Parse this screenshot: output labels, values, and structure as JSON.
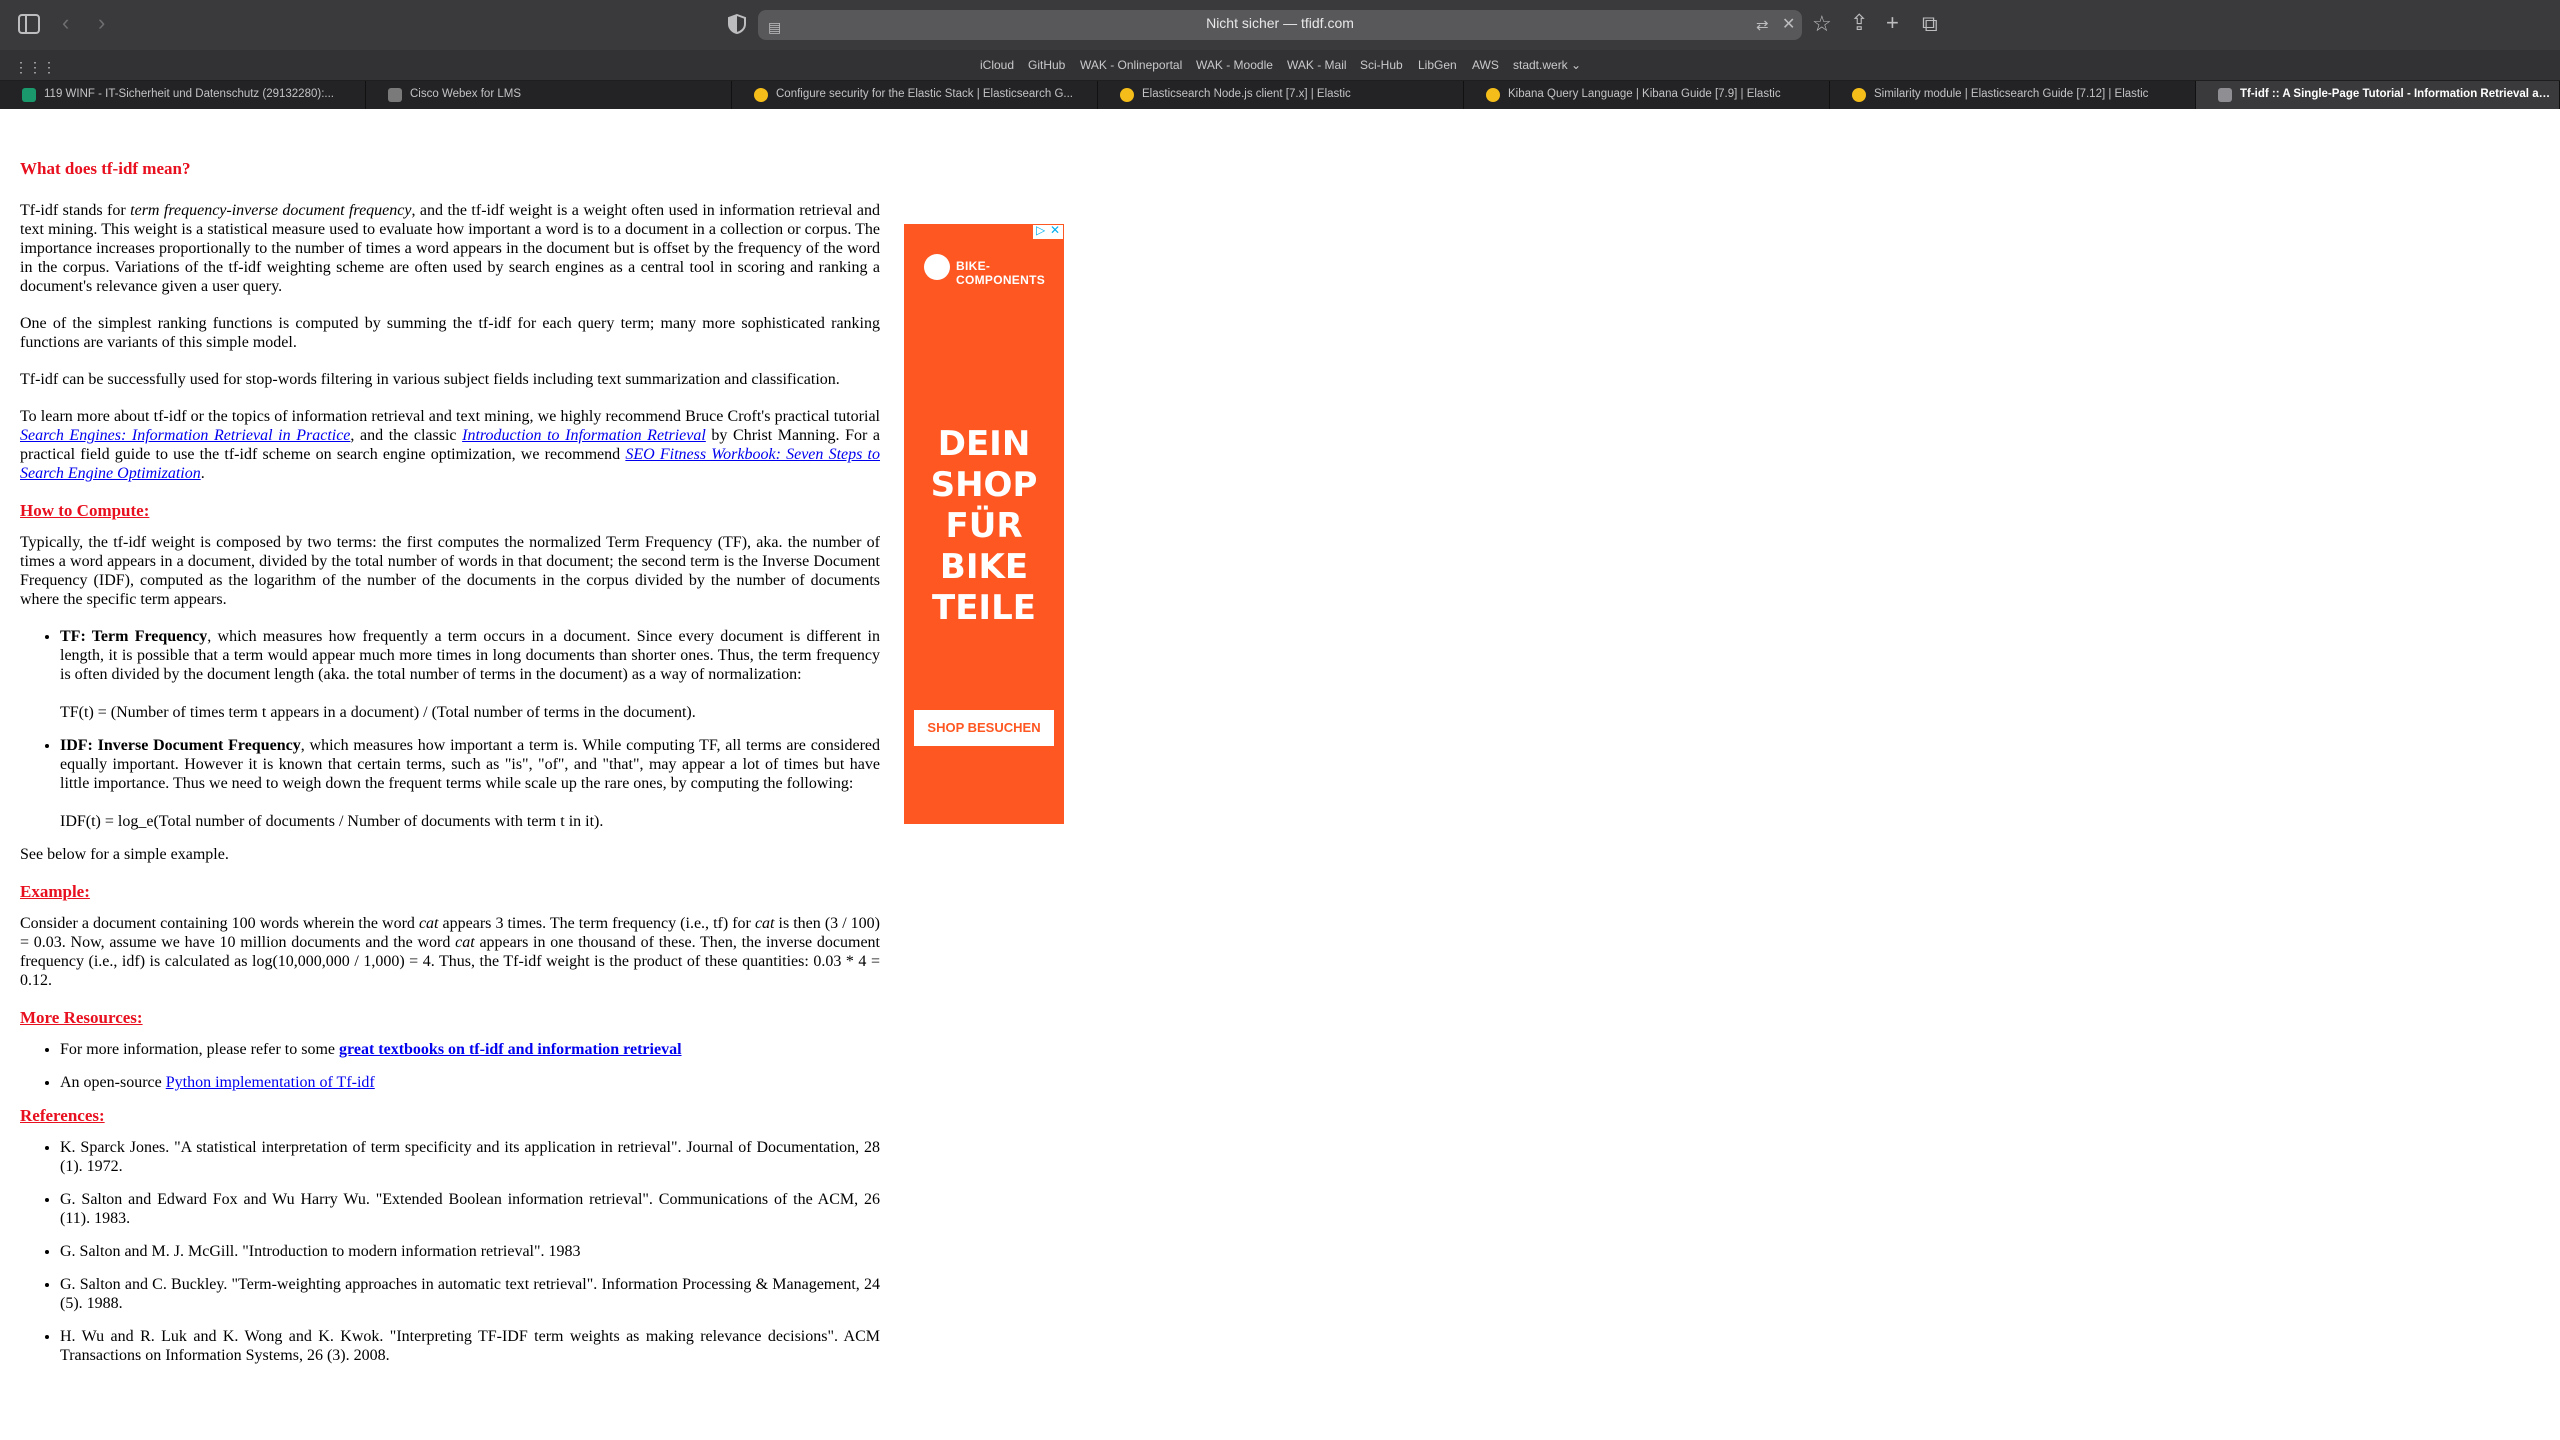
{
  "browser": {
    "address_text": "Nicht sicher — tfidf.com",
    "favorites": [
      "iCloud",
      "GitHub",
      "WAK - Onlineportal",
      "WAK - Moodle",
      "WAK - Mail",
      "Sci-Hub",
      "LibGen",
      "AWS",
      "stadt.werk ⌄"
    ],
    "tabs": [
      {
        "label": "119 WINF - IT-Sicherheit und Datenschutz (29132280):...",
        "favicon_color": "#1a9a6c"
      },
      {
        "label": "Cisco Webex for LMS",
        "favicon_color": "#7a7a7a"
      },
      {
        "label": "Configure security for the Elastic Stack | Elasticsearch G...",
        "favicon_color": "#f4bd19"
      },
      {
        "label": "Elasticsearch Node.js client [7.x] | Elastic",
        "favicon_color": "#f4bd19"
      },
      {
        "label": "Kibana Query Language | Kibana Guide [7.9] | Elastic",
        "favicon_color": "#f4bd19"
      },
      {
        "label": "Similarity module | Elasticsearch Guide [7.12] | Elastic",
        "favicon_color": "#f4bd19"
      },
      {
        "label": "Tf-idf :: A Single-Page Tutorial - Information Retrieval an...",
        "favicon_color": "#8e8e93"
      }
    ]
  },
  "article": {
    "title": "What does tf-idf mean?",
    "intro_1": "Tf-idf stands for ",
    "intro_em": "term frequency-inverse document frequency",
    "intro_2": ", and the tf-idf weight is a weight often used in information retrieval and text mining. This weight is a statistical measure used to evaluate how important a word is to a document in a collection or corpus. The importance increases proportionally to the number of times a word appears in the document but is offset by the frequency of the word in the corpus. Variations of the tf-idf weighting scheme are often used by search engines as a central tool in scoring and ranking a document's relevance given a user query.",
    "para_2": "One of the simplest ranking functions is computed by summing the tf-idf for each query term; many more sophisticated ranking functions are variants of this simple model.",
    "para_3": "Tf-idf can be successfully used for stop-words filtering in various subject fields including text summarization and classification.",
    "para_4a": "To learn more about tf-idf or the topics of information retrieval and text mining, we highly recommend Bruce Croft's practical tutorial ",
    "link_1": "Search Engines: Information Retrieval in Practice",
    "para_4b": ", and the classic ",
    "link_2": "Introduction to Information Retrieval",
    "para_4c": " by Christ Manning. For a practical field guide to use the tf-idf scheme on search engine optimization, we recommend ",
    "link_3": "SEO Fitness Workbook: Seven Steps to Search Engine Optimization",
    "para_4d": ".",
    "h_compute": "How to Compute:",
    "compute_p": "Typically, the tf-idf weight is composed by two terms: the first computes the normalized Term Frequency (TF), aka. the number of times a word appears in a document, divided by the total number of words in that document; the second term is the Inverse Document Frequency (IDF), computed as the logarithm of the number of the documents in the corpus divided by the number of documents where the specific term appears.",
    "tf_title": "TF: Term Frequency",
    "tf_text": ", which measures how frequently a term occurs in a document. Since every document is different in length, it is possible that a term would appear much more times in long documents than shorter ones. Thus, the term frequency is often divided by the document length (aka. the total number of terms in the document) as a way of normalization:",
    "tf_formula": "TF(t) = (Number of times term t appears in a document) / (Total number of terms in the document).",
    "idf_title": "IDF: Inverse Document Frequency",
    "idf_text": ", which measures how important a term is. While computing TF, all terms are considered equally important. However it is known that certain terms, such as \"is\", \"of\", and \"that\", may appear a lot of times but have little importance. Thus we need to weigh down the frequent terms while scale up the rare ones, by computing the following:",
    "idf_formula": "IDF(t) = log_e(Total number of documents / Number of documents with term t in it).",
    "see_below": "See below for a simple example.",
    "h_example": "Example:",
    "ex_1": "Consider a document containing 100 words wherein the word ",
    "ex_cat1": "cat",
    "ex_2": " appears 3 times. The term frequency (i.e., tf) for ",
    "ex_cat2": "cat",
    "ex_3": " is then (3 / 100) = 0.03. Now, assume we have 10 million documents and the word ",
    "ex_cat3": "cat",
    "ex_4": " appears in one thousand of these. Then, the inverse document frequency (i.e., idf) is calculated as log(10,000,000 / 1,000) = 4. Thus, the Tf-idf weight is the product of these quantities: 0.03 * 4 = 0.12.",
    "h_resources": "More Resources:",
    "res_1_text": "For more information, please refer to some ",
    "res_1_link": "great textbooks on tf-idf and information retrieval",
    "res_2_text": "An open-source ",
    "res_2_link": "Python implementation of Tf-idf",
    "h_references": "References:",
    "references": [
      "K. Sparck Jones. \"A statistical interpretation of term specificity and its application in retrieval\". Journal of Documentation, 28 (1). 1972.",
      "G. Salton and Edward Fox and Wu Harry Wu. \"Extended Boolean information retrieval\". Communications of the ACM, 26 (11). 1983.",
      "G. Salton and M. J. McGill. \"Introduction to modern information retrieval\". 1983",
      "G. Salton and C. Buckley. \"Term-weighting approaches in automatic text retrieval\". Information Processing & Management, 24 (5). 1988.",
      "H. Wu and R. Luk and K. Wong and K. Kwok. \"Interpreting TF-IDF term weights as making relevance decisions\". ACM Transactions on Information Systems, 26 (3). 2008."
    ]
  },
  "ad": {
    "brand": "BIKE-COMPONENTS",
    "headline_lines": [
      "DEIN",
      "SHOP",
      "FÜR",
      "BIKE",
      "TEILE"
    ],
    "button": "SHOP BESUCHEN",
    "color": "#ff5722"
  }
}
